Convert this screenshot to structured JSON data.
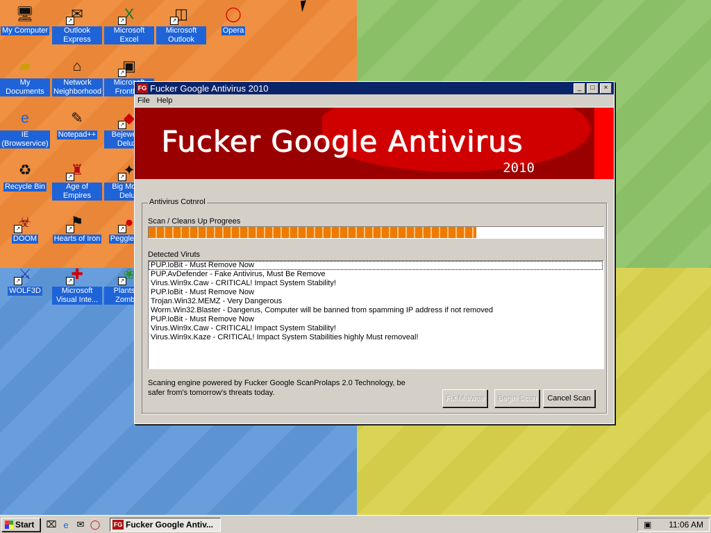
{
  "desktop": {
    "icons": [
      {
        "label": "My Computer",
        "icon": "computer-icon"
      },
      {
        "label": "Outlook Express",
        "icon": "outlook-express-icon"
      },
      {
        "label": "Microsoft Excel",
        "icon": "excel-icon"
      },
      {
        "label": "Microsoft Outlook",
        "icon": "outlook-icon"
      },
      {
        "label": "Opera",
        "icon": "opera-icon"
      },
      {
        "label": "My Documents",
        "icon": "documents-folder-icon"
      },
      {
        "label": "Network Neighborhood",
        "icon": "network-icon"
      },
      {
        "label": "Microsoft FrontP...",
        "icon": "frontpage-icon"
      },
      {
        "label": "IE (Browservice)",
        "icon": "internet-explorer-icon"
      },
      {
        "label": "Notepad++",
        "icon": "notepad-plus-plus-icon"
      },
      {
        "label": "Bejeweled Deluxe",
        "icon": "bejeweled-icon"
      },
      {
        "label": "Recycle Bin",
        "icon": "recycle-bin-icon"
      },
      {
        "label": "Age of Empires",
        "icon": "age-of-empires-icon"
      },
      {
        "label": "Big Mon... Delux",
        "icon": "big-money-icon"
      },
      {
        "label": "DOOM",
        "icon": "doom-icon"
      },
      {
        "label": "Hearts of Iron",
        "icon": "hearts-of-iron-icon"
      },
      {
        "label": "Peggle D...",
        "icon": "peggle-icon"
      },
      {
        "label": "WOLF3D",
        "icon": "wolf3d-icon"
      },
      {
        "label": "Microsoft Visual Inte...",
        "icon": "visual-interdev-icon"
      },
      {
        "label": "Plants vs Zombi...",
        "icon": "plants-vs-zombies-icon"
      }
    ]
  },
  "window": {
    "logo": "FG",
    "title": "Fucker Google Antivirus 2010",
    "menu": [
      "File",
      "Help"
    ],
    "banner_title": "Fucker Google Antivirus",
    "banner_year": "2010",
    "group_label": "Antivirus Cotnrol",
    "scan_label": "Scan / Cleans Up Progrees",
    "progress": 0.72,
    "detected_label": "Detected Viruts",
    "detections": [
      "PUP.IoBit - Must Remove Now",
      "PUP.AvDefender - Fake Antivirus, Must Be Remove",
      "Virus.Win9x.Caw - CRITICAL! Impact System Stability!",
      "PUP.IoBit - Must Remove Now",
      "Trojan.Win32.MEMZ - Very Dangerous",
      "Worm.Win32.Blaster - Dangerus, Computer will be banned from spamming IP address if not removed",
      "PUP.IoBit - Must Remove Now",
      "Virus.Win9x.Caw - CRITICAL! Impact System Stability!",
      "Virus.Win9x.Kaze - CRITICAL! Impact System Stabilities highly Must removeal!"
    ],
    "footer_text": "Scaning engine powered by Fucker Google ScanProlaps 2.0 Technology, be safer from's tomorrow's threats today.",
    "buttons": {
      "fix": "Fix Malwae",
      "begin": "Begin Scan",
      "cancel": "Cancel Scan"
    }
  },
  "taskbar": {
    "start": "Start",
    "task_label": "Fucker Google Antiv...",
    "time": "11:06 AM"
  }
}
